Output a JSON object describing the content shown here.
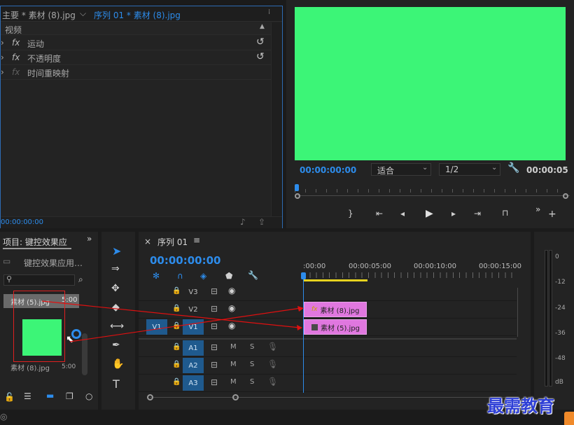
{
  "effects_panel": {
    "tab_main": "主要 * 素材 (8).jpg",
    "tab_seq": "序列 01 * 素材 (8).jpg",
    "section": "视频",
    "effects": [
      {
        "fx": "fx",
        "label": "运动"
      },
      {
        "fx": "fx",
        "label": "不透明度"
      },
      {
        "fx": "fx",
        "label": "时间重映射"
      }
    ],
    "timecode": "00:00:00:00"
  },
  "program_monitor": {
    "frame_color": "#3cf577",
    "timecode": "00:00:00:00",
    "fit": "适合",
    "resolution": "1/2",
    "duration": "00:00:05"
  },
  "project_panel": {
    "title": "项目: 键控效果应",
    "bin": "键控效果应用…",
    "items": [
      {
        "name": "素材 (5).jpg",
        "dur": "5:00"
      },
      {
        "name": "素材 (8).jpg",
        "dur": "5:00"
      }
    ],
    "thumb_color": "#3cf577"
  },
  "timeline": {
    "close": "×",
    "title": "序列 01",
    "menu": "≡",
    "timecode": "00:00:00:00",
    "ruler": [
      ":00:00",
      "00:00:05:00",
      "00:00:10:00",
      "00:00:15:00"
    ],
    "video_tracks": [
      {
        "name": "V3"
      },
      {
        "name": "V2"
      },
      {
        "name": "V1",
        "source": "V1"
      }
    ],
    "audio_tracks": [
      {
        "name": "A1",
        "m": "M",
        "s": "S"
      },
      {
        "name": "A2",
        "m": "M",
        "s": "S"
      },
      {
        "name": "A3",
        "m": "M",
        "s": "S"
      }
    ],
    "clips": [
      {
        "track": "V2",
        "label": "素材 (8).jpg",
        "fx": "fx"
      },
      {
        "track": "V1",
        "label": "素材 (5).jpg"
      }
    ],
    "clip_color": "#e077df",
    "playhead_color": "#2d8ceb"
  },
  "audio_meter": {
    "scale": [
      "0",
      "-12",
      "-24",
      "-36",
      "-48",
      "dB"
    ]
  },
  "watermark": "最需教育"
}
